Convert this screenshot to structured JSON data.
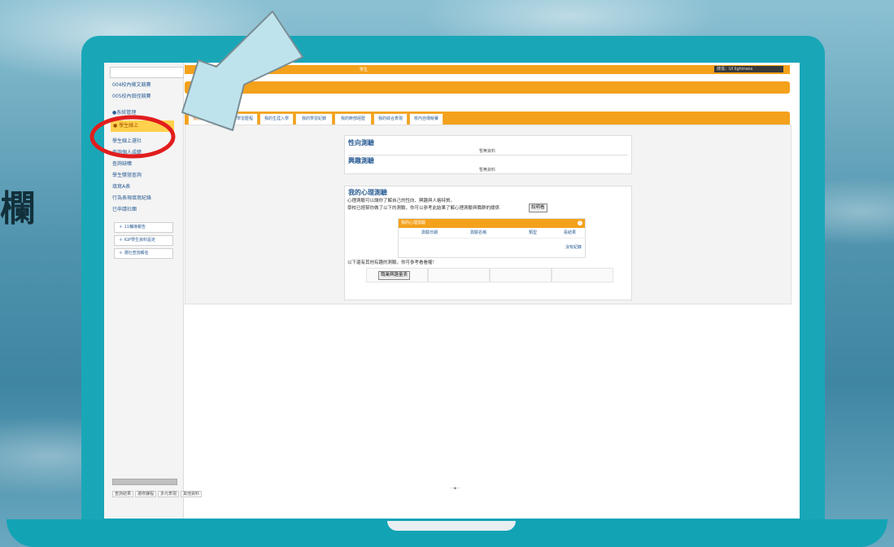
{
  "side_text": "欄",
  "top_bar": {
    "link": "學生",
    "search": "搜尋：UI lightness"
  },
  "left_nav": {
    "items": [
      {
        "label": "004校內徵文競賽"
      },
      {
        "label": "005校內田徑競賽"
      },
      {
        "label": "●系統管理"
      },
      {
        "label": "● 學生線上",
        "highlighted": true
      },
      {
        "label": "學生線上選社"
      },
      {
        "label": "查詢個人成績"
      },
      {
        "label": "查詢缺曠"
      },
      {
        "label": "學生獎懲查詢"
      },
      {
        "label": "填寫A表"
      },
      {
        "label": "行為表現填寫紀錄"
      },
      {
        "label": "已申請社團"
      }
    ],
    "buttons": [
      {
        "label": "＋ 11輔導報告"
      },
      {
        "label": "＋ IGP學生資料設定"
      },
      {
        "label": "＋ 選社查詢報名"
      }
    ],
    "bottom_tabs": [
      "查詢結果",
      "選修課程",
      "多元表現",
      "其他資料"
    ]
  },
  "tabs": [
    {
      "label": "我的心理測驗",
      "active": true
    },
    {
      "label": "我的學習歷程"
    },
    {
      "label": "我的生涯入學"
    },
    {
      "label": "我的學習紀錄"
    },
    {
      "label": "我的幹部經歷"
    },
    {
      "label": "我的綜合表現"
    },
    {
      "label": "校內自傳競賽"
    }
  ],
  "panel1": {
    "title1": "性向測驗",
    "note1": "暫無資料",
    "title2": "興趣測驗",
    "note2": "暫無資料"
  },
  "panel2": {
    "title": "我的心理測驗",
    "line1": "心理測驗可以讓你了解自己的性向、興趣與人格特質。",
    "line2": "學校已經幫你做了以下的測驗，你可以參考此結果了解心理測驗與職群的關係",
    "check_button": "說明看",
    "table_title": "我的心理測驗",
    "columns": [
      "測驗日期",
      "測驗名稱",
      "類型",
      "看結果"
    ],
    "empty": "沒有紀錄",
    "line3": "以下還有其他有趣的測驗，你可參考看看喔！",
    "link_button": "職業興趣量表"
  },
  "colors": {
    "accent": "#f4a11c",
    "laptop": "#19a7b8",
    "circle": "#e11d1d",
    "arrow": "#bfe3ec"
  }
}
